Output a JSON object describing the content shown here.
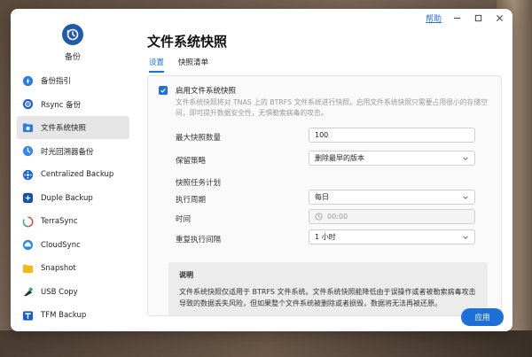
{
  "titlebar": {
    "help": "帮助"
  },
  "app": {
    "name": "备份"
  },
  "sidebar": {
    "items": [
      {
        "label": "备份指引",
        "icon": "compass-icon"
      },
      {
        "label": "Rsync 备份",
        "icon": "rsync-icon"
      },
      {
        "label": "文件系统快照",
        "icon": "snapshot-folder-icon",
        "active": true
      },
      {
        "label": "时光回溯器备份",
        "icon": "time-machine-icon"
      },
      {
        "label": "Centralized Backup",
        "icon": "centralized-backup-icon"
      },
      {
        "label": "Duple Backup",
        "icon": "duple-backup-icon"
      },
      {
        "label": "TerraSync",
        "icon": "terrasync-icon"
      },
      {
        "label": "CloudSync",
        "icon": "cloudsync-icon"
      },
      {
        "label": "Snapshot",
        "icon": "snapshot-icon"
      },
      {
        "label": "USB Copy",
        "icon": "usb-copy-icon"
      },
      {
        "label": "TFM Backup",
        "icon": "tfm-backup-icon"
      }
    ]
  },
  "main": {
    "title": "文件系统快照",
    "tabs": [
      {
        "label": "设置",
        "active": true
      },
      {
        "label": "快照清单",
        "active": false
      }
    ]
  },
  "form": {
    "enable_label": "启用文件系统快照",
    "enabled": true,
    "description": "文件系统快照将对 TNAS 上的 BTRFS 文件系统进行快照。启用文件系统快照只需要占用很小的存储空间，即可提升数据安全性，无惧勒索病毒的攻击。",
    "max_label": "最大快照数量",
    "max_value": "100",
    "retention_label": "保留策略",
    "retention_value": "删除最早的版本",
    "schedule_label": "快照任务计划",
    "period_label": "执行周期",
    "period_value": "每日",
    "time_label": "时间",
    "time_value": "00:00",
    "repeat_label": "重复执行间隔",
    "repeat_value": "1 小时"
  },
  "info": {
    "title": "说明",
    "text": "文件系统快照仅适用于 BTRFS 文件系统。文件系统快照能降低由于误操作或者被勒索病毒攻击导致的数据丢失风险，但如果整个文件系统被删除或者损毁，数据将无法再被还原。"
  },
  "footer": {
    "apply": "应用"
  },
  "colors": {
    "accent": "#1f6fd9",
    "app_icon": "#1f5ba8"
  }
}
